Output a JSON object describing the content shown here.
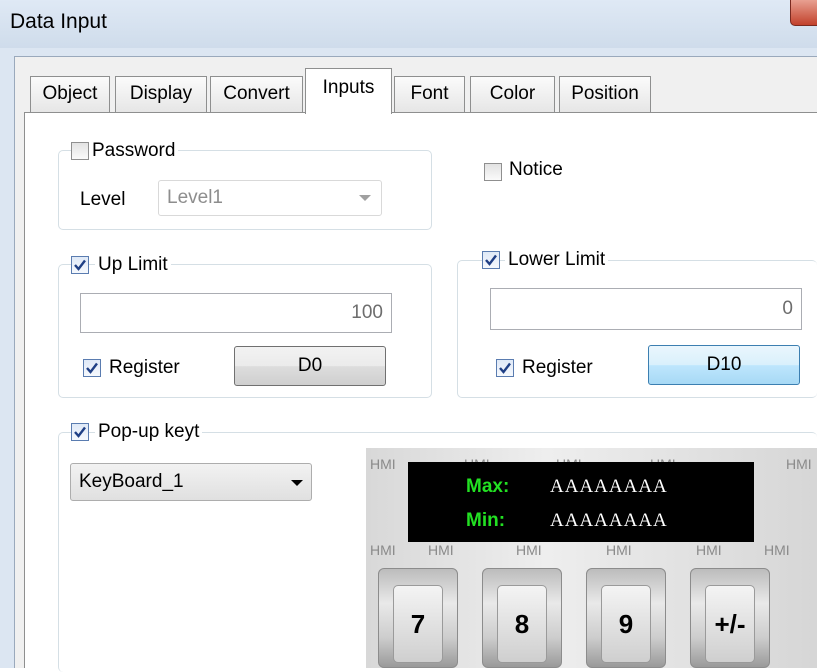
{
  "window": {
    "title": "Data Input"
  },
  "tabs": [
    {
      "label": "Object"
    },
    {
      "label": "Display"
    },
    {
      "label": "Convert"
    },
    {
      "label": "Inputs"
    },
    {
      "label": "Font"
    },
    {
      "label": "Color"
    },
    {
      "label": "Position"
    }
  ],
  "active_tab": "Inputs",
  "password": {
    "label": "Password",
    "checked": false,
    "level_label": "Level",
    "level_value": "Level1"
  },
  "notice": {
    "label": "Notice",
    "checked": false
  },
  "up_limit": {
    "label": "Up Limit",
    "checked": true,
    "value": "100",
    "register_label": "Register",
    "register_checked": true,
    "address": "D0"
  },
  "lower_limit": {
    "label": "Lower Limit",
    "checked": true,
    "value": "0",
    "register_label": "Register",
    "register_checked": true,
    "address": "D10"
  },
  "popup": {
    "label": "Pop-up keyt",
    "checked": true,
    "keyboard": "KeyBoard_1"
  },
  "preview": {
    "watermark": "HMI",
    "max_label": "Max:",
    "max_value": "AAAAAAAA",
    "min_label": "Min:",
    "min_value": "AAAAAAAA",
    "keys": [
      "7",
      "8",
      "9",
      "+/-"
    ]
  },
  "colors": {
    "display_bg": "#000000",
    "display_label": "#22e022",
    "display_value": "#ffffff",
    "title_bar": "#dfe9f5"
  }
}
